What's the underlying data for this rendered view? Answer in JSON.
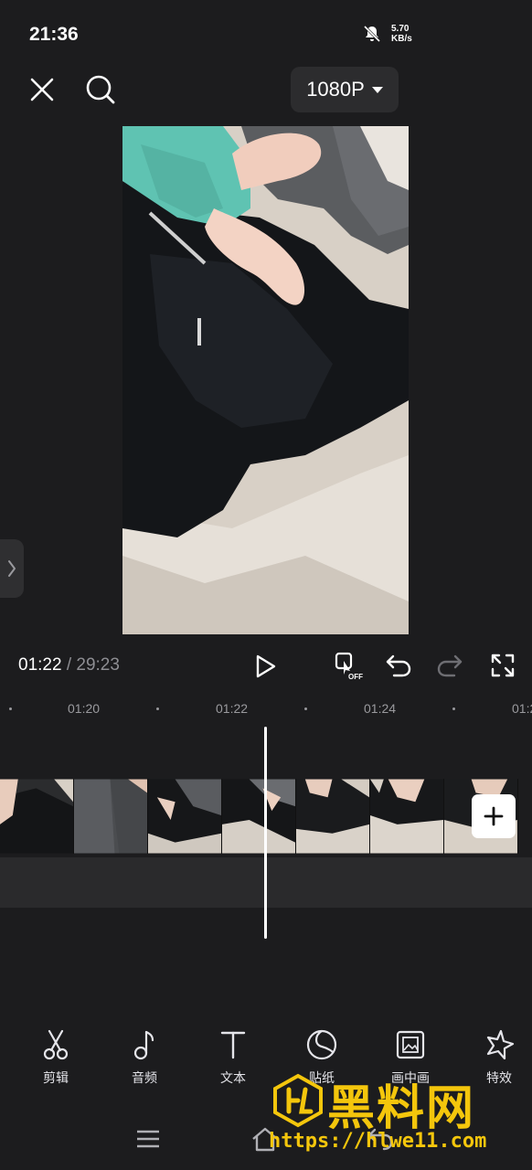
{
  "status_bar": {
    "time": "21:36",
    "net_speed_value": "5.70",
    "net_speed_unit": "KB/s"
  },
  "top_bar": {
    "resolution": "1080P"
  },
  "playback": {
    "current_time": "01:22",
    "separator": "/",
    "total_time": "29:23"
  },
  "timeline": {
    "ruler_labels": [
      "01:20",
      "01:22",
      "01:24",
      "01:2"
    ]
  },
  "toolbar": {
    "items": [
      {
        "label": "剪辑",
        "icon": "scissors-icon"
      },
      {
        "label": "音频",
        "icon": "music-note-icon"
      },
      {
        "label": "文本",
        "icon": "text-icon"
      },
      {
        "label": "贴纸",
        "icon": "sticker-icon"
      },
      {
        "label": "画中画",
        "icon": "picture-in-picture-icon"
      },
      {
        "label": "特效",
        "icon": "effects-star-icon"
      }
    ]
  },
  "watermark": {
    "title": "黑料网",
    "url": "https://hlwe11.com"
  },
  "colors": {
    "background": "#1c1c1e",
    "accent_watermark": "#f4c60c",
    "button_bg": "#2c2c2e"
  }
}
